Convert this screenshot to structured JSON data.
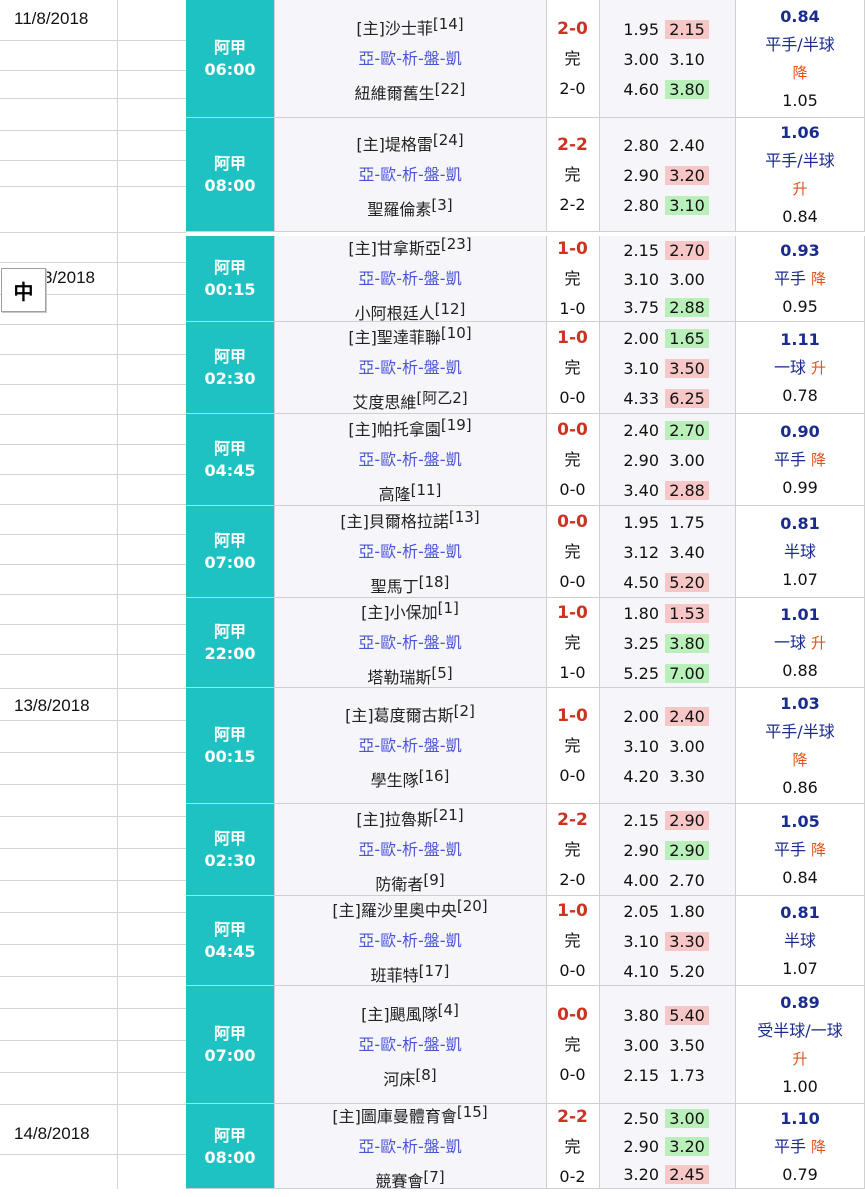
{
  "sheet": {
    "dates": [
      "11/8/2018",
      "3/2018",
      "13/8/2018",
      "14/8/2018"
    ],
    "ime_indicator": "中"
  },
  "links": [
    "亞",
    "歐",
    "析",
    "盤",
    "凱"
  ],
  "home_tag": "[主]",
  "matches": [
    {
      "league": "阿甲",
      "time": "06:00",
      "home": "沙士菲",
      "home_rank": "14",
      "away": "紐維爾舊生",
      "away_rank": "22",
      "score": "2-0",
      "status": "完",
      "ht": "2-0",
      "odds": [
        [
          "1.95",
          "2.15",
          "pink"
        ],
        [
          "3.00",
          "3.10",
          ""
        ],
        [
          "4.60",
          "3.80",
          "green"
        ]
      ],
      "asian": {
        "top": "0.84",
        "line": "平手/半球",
        "dir": "降",
        "bottom": "1.05"
      }
    },
    {
      "league": "阿甲",
      "time": "08:00",
      "home": "堤格雷",
      "home_rank": "24",
      "away": "聖羅倫素",
      "away_rank": "3",
      "score": "2-2",
      "status": "完",
      "ht": "2-2",
      "odds": [
        [
          "2.80",
          "2.40",
          ""
        ],
        [
          "2.90",
          "3.20",
          "pink"
        ],
        [
          "2.80",
          "3.10",
          "green"
        ]
      ],
      "asian": {
        "top": "1.06",
        "line": "平手/半球",
        "dir": "升",
        "bottom": "0.84"
      }
    },
    {
      "league": "阿甲",
      "time": "00:15",
      "home": "甘拿斯亞",
      "home_rank": "23",
      "away": "小阿根廷人",
      "away_rank": "12",
      "score": "1-0",
      "status": "完",
      "ht": "1-0",
      "odds": [
        [
          "2.15",
          "2.70",
          "pink"
        ],
        [
          "3.10",
          "3.00",
          ""
        ],
        [
          "3.75",
          "2.88",
          "green"
        ]
      ],
      "asian": {
        "top": "0.93",
        "line": "平手",
        "dir": "降",
        "bottom": "0.95"
      }
    },
    {
      "league": "阿甲",
      "time": "02:30",
      "home": "聖達菲聯",
      "home_rank": "10",
      "away": "艾度思維",
      "away_rank": "阿乙2",
      "score": "1-0",
      "status": "完",
      "ht": "0-0",
      "odds": [
        [
          "2.00",
          "1.65",
          "green"
        ],
        [
          "3.10",
          "3.50",
          "pink"
        ],
        [
          "4.33",
          "6.25",
          "pink"
        ]
      ],
      "asian": {
        "top": "1.11",
        "line": "一球",
        "dir": "升",
        "bottom": "0.78"
      }
    },
    {
      "league": "阿甲",
      "time": "04:45",
      "home": "帕托拿園",
      "home_rank": "19",
      "away": "高隆",
      "away_rank": "11",
      "score": "0-0",
      "status": "完",
      "ht": "0-0",
      "odds": [
        [
          "2.40",
          "2.70",
          "green"
        ],
        [
          "2.90",
          "3.00",
          ""
        ],
        [
          "3.40",
          "2.88",
          "pink"
        ]
      ],
      "asian": {
        "top": "0.90",
        "line": "平手",
        "dir": "降",
        "bottom": "0.99"
      }
    },
    {
      "league": "阿甲",
      "time": "07:00",
      "home": "貝爾格拉諾",
      "home_rank": "13",
      "away": "聖馬丁",
      "away_rank": "18",
      "score": "0-0",
      "status": "完",
      "ht": "0-0",
      "odds": [
        [
          "1.95",
          "1.75",
          ""
        ],
        [
          "3.12",
          "3.40",
          ""
        ],
        [
          "4.50",
          "5.20",
          "pink"
        ]
      ],
      "asian": {
        "top": "0.81",
        "line": "半球",
        "dir": "",
        "bottom": "1.07"
      }
    },
    {
      "league": "阿甲",
      "time": "22:00",
      "home": "小保加",
      "home_rank": "1",
      "away": "塔勒瑞斯",
      "away_rank": "5",
      "score": "1-0",
      "status": "完",
      "ht": "1-0",
      "odds": [
        [
          "1.80",
          "1.53",
          "pink"
        ],
        [
          "3.25",
          "3.80",
          "green"
        ],
        [
          "5.25",
          "7.00",
          "green"
        ]
      ],
      "asian": {
        "top": "1.01",
        "line": "一球",
        "dir": "升",
        "bottom": "0.88"
      }
    },
    {
      "league": "阿甲",
      "time": "00:15",
      "home": "葛度爾古斯",
      "home_rank": "2",
      "away": "學生隊",
      "away_rank": "16",
      "score": "1-0",
      "status": "完",
      "ht": "0-0",
      "odds": [
        [
          "2.00",
          "2.40",
          "pink"
        ],
        [
          "3.10",
          "3.00",
          ""
        ],
        [
          "4.20",
          "3.30",
          ""
        ]
      ],
      "asian": {
        "top": "1.03",
        "line": "平手/半球",
        "dir": "降",
        "bottom": "0.86"
      }
    },
    {
      "league": "阿甲",
      "time": "02:30",
      "home": "拉魯斯",
      "home_rank": "21",
      "away": "防衛者",
      "away_rank": "9",
      "score": "2-2",
      "status": "完",
      "ht": "2-0",
      "odds": [
        [
          "2.15",
          "2.90",
          "pink"
        ],
        [
          "2.90",
          "2.90",
          "green"
        ],
        [
          "4.00",
          "2.70",
          ""
        ]
      ],
      "asian": {
        "top": "1.05",
        "line": "平手",
        "dir": "降",
        "bottom": "0.84"
      }
    },
    {
      "league": "阿甲",
      "time": "04:45",
      "home": "羅沙里奧中央",
      "home_rank": "20",
      "away": "班菲特",
      "away_rank": "17",
      "score": "1-0",
      "status": "完",
      "ht": "0-0",
      "odds": [
        [
          "2.05",
          "1.80",
          ""
        ],
        [
          "3.10",
          "3.30",
          "pink"
        ],
        [
          "4.10",
          "5.20",
          ""
        ]
      ],
      "asian": {
        "top": "0.81",
        "line": "半球",
        "dir": "",
        "bottom": "1.07"
      }
    },
    {
      "league": "阿甲",
      "time": "07:00",
      "home": "颶風隊",
      "home_rank": "4",
      "away": "河床",
      "away_rank": "8",
      "score": "0-0",
      "status": "完",
      "ht": "0-0",
      "odds": [
        [
          "3.80",
          "5.40",
          "pink"
        ],
        [
          "3.00",
          "3.50",
          ""
        ],
        [
          "2.15",
          "1.73",
          ""
        ]
      ],
      "asian": {
        "top": "0.89",
        "line": "受半球/一球",
        "dir": "升",
        "bottom": "1.00"
      }
    },
    {
      "league": "阿甲",
      "time": "08:00",
      "home": "圖庫曼體育會",
      "home_rank": "15",
      "away": "競賽會",
      "away_rank": "7",
      "score": "2-2",
      "status": "完",
      "ht": "0-2",
      "odds": [
        [
          "2.50",
          "3.00",
          "green"
        ],
        [
          "2.90",
          "3.20",
          "green"
        ],
        [
          "3.20",
          "2.45",
          "pink"
        ]
      ],
      "asian": {
        "top": "1.10",
        "line": "平手",
        "dir": "降",
        "bottom": "0.79"
      }
    }
  ]
}
